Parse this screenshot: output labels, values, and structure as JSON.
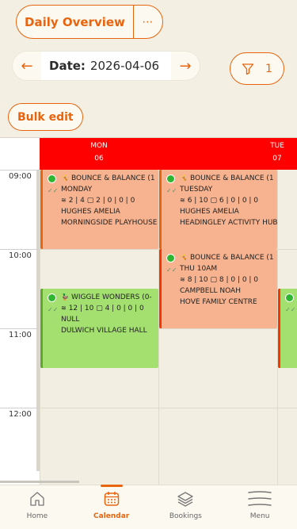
{
  "header": {
    "title": "Daily Overview",
    "more_label": "⋯"
  },
  "date_nav": {
    "prev": "←",
    "label": "Date:",
    "value": "2026-04-06",
    "next": "→"
  },
  "filter": {
    "count": "1"
  },
  "bulk_edit": "Bulk edit",
  "calendar": {
    "days": [
      {
        "dow": "MON",
        "num": "06"
      },
      {
        "dow": "TUE",
        "num": "07"
      }
    ],
    "times": [
      "09:00",
      "10:00",
      "11:00",
      "12:00"
    ],
    "events": [
      {
        "title": "BOUNCE & BALANCE (1",
        "day": "MONDAY",
        "stats": "2 | 4 ▢ 2 | 0 | 0 | 0",
        "coach": "HUGHES AMELIA",
        "venue": "MORNINGSIDE PLAYHOUSE"
      },
      {
        "title": "BOUNCE & BALANCE (1",
        "day": "TUESDAY",
        "stats": "6 | 10 ▢ 6 | 0 | 0 | 0",
        "coach": "HUGHES AMELIA",
        "venue": "HEADINGLEY ACTIVITY HUB"
      },
      {
        "title": "BOUNCE & BALANCE (1",
        "day": "THU 10AM",
        "stats": "8 | 10 ▢ 8 | 0 | 0 | 0",
        "coach": "CAMPBELL NOAH",
        "venue": "HOVE FAMILY CENTRE"
      },
      {
        "title": "WIGGLE WONDERS (0-",
        "day": "",
        "stats": "12 | 10 ▢ 4 | 0 | 0 | 0",
        "coach": "NULL",
        "venue": "DULWICH VILLAGE HALL"
      }
    ]
  },
  "nav": [
    {
      "label": "Home",
      "icon": "home-icon"
    },
    {
      "label": "Calendar",
      "icon": "calendar-icon"
    },
    {
      "label": "Bookings",
      "icon": "layers-icon"
    },
    {
      "label": "Menu",
      "icon": "menu-icon"
    }
  ],
  "colors": {
    "accent": "#e8640f",
    "header_red": "#ff0000",
    "event_orange": "#f7b38f",
    "event_green": "#a3e070"
  }
}
